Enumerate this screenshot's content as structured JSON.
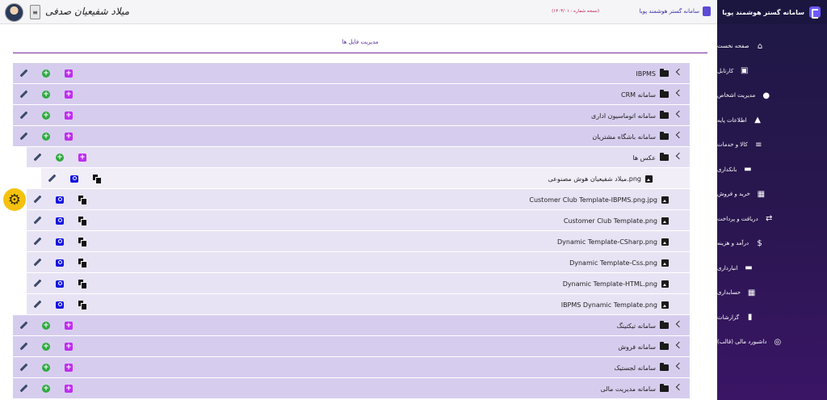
{
  "sidebar": {
    "brand": "سامانه گستر هوشمند پویا",
    "items": [
      {
        "label": "صفحه نخست",
        "icon": "home-icon",
        "glyph": "⌂"
      },
      {
        "label": "کارتابل",
        "icon": "briefcase-icon",
        "glyph": "▣"
      },
      {
        "label": "مدیریت اشخاص",
        "icon": "person-icon",
        "glyph": "●"
      },
      {
        "label": "اطلاعات پایه",
        "icon": "lock-icon",
        "glyph": "▲"
      },
      {
        "label": "کالا و خدمات",
        "icon": "list-icon",
        "glyph": "≡"
      },
      {
        "label": "بانکداری",
        "icon": "card-icon",
        "glyph": "▬"
      },
      {
        "label": "خرید و فروش",
        "icon": "table-icon",
        "glyph": "▦"
      },
      {
        "label": "دریافت و پرداخت",
        "icon": "swap-icon",
        "glyph": "⇄"
      },
      {
        "label": "درآمد و هزینه",
        "icon": "dollar-icon",
        "glyph": "$"
      },
      {
        "label": "انبارداری",
        "icon": "folder-icon",
        "glyph": "▬"
      },
      {
        "label": "حسابداری",
        "icon": "calculator-icon",
        "glyph": "▦"
      },
      {
        "label": "گزارشات",
        "icon": "chart-icon",
        "glyph": "▮"
      },
      {
        "label": "داشبورد مالی (قالب)",
        "icon": "dashboard-icon",
        "glyph": "◎"
      }
    ]
  },
  "topbar": {
    "user_name": "میلاد شفیعیان صدفی",
    "user_box": "≡",
    "app_title": "سامانه گستر هوشمند پویا",
    "version": "(نسخه شماره : ۱۴۰۳/۰۱)"
  },
  "page": {
    "title": "مدیریت فایل ها"
  },
  "tree": {
    "top_folders_before": [
      {
        "name": "IBPMS"
      },
      {
        "name": "CRM سامانه"
      },
      {
        "name": "سامانه اتوماسیون اداری"
      },
      {
        "name": "سامانه باشگاه مشتریان"
      }
    ],
    "subfolder": {
      "name": "عکس ها"
    },
    "subfolder_file": {
      "name": "میلاد شفیعیان هوش مصنوعی.png"
    },
    "files": [
      {
        "name": "Customer Club Template-IBPMS.png.jpg"
      },
      {
        "name": "Customer Club Template.png"
      },
      {
        "name": "Dynamic Template-CSharp.png"
      },
      {
        "name": "Dynamic Template-Css.png"
      },
      {
        "name": "Dynamic Template-HTML.png"
      },
      {
        "name": "IBPMS Dynamic Template.png"
      }
    ],
    "top_folders_after": [
      {
        "name": "سامانه تیکتینگ"
      },
      {
        "name": "سامانه فروش"
      },
      {
        "name": "سامانه لجستیک"
      },
      {
        "name": "سامانه مدیریت مالی"
      }
    ]
  },
  "fab": {
    "icon": "gear-icon",
    "glyph": "⚙"
  }
}
